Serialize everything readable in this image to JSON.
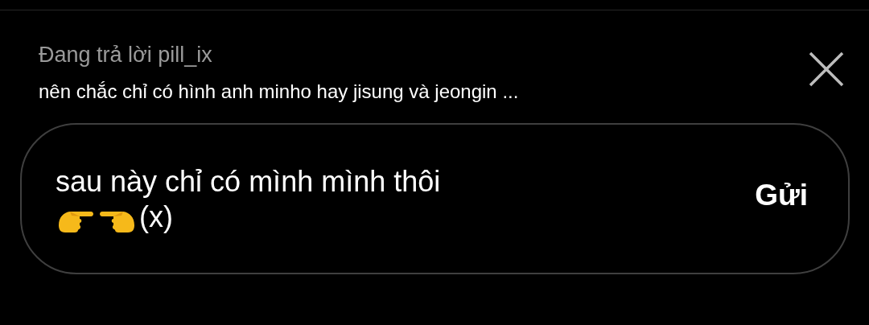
{
  "reply_banner": {
    "label": "Đang trả lời pill_ix",
    "preview": "nên chắc chỉ có hình anh minho hay jisung và jeongin ..."
  },
  "composer": {
    "value_line": "sau này chỉ có mình mình thôi",
    "value_tail": "(x)",
    "send": "Gửi"
  }
}
